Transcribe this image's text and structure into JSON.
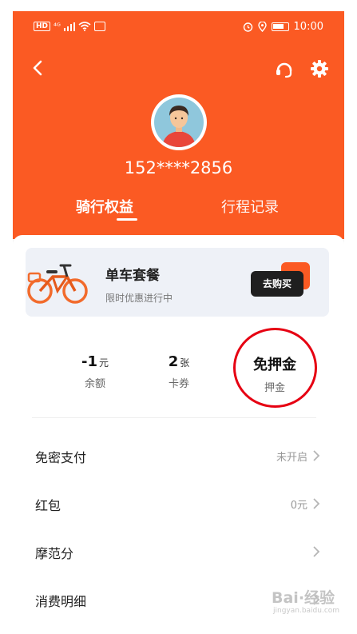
{
  "status_bar": {
    "hd": "HD",
    "signal": "⁴ᴳ",
    "time": "10:00"
  },
  "header": {
    "bg_color": "#fb5a23",
    "phone": "152****2856",
    "tabs": [
      {
        "label": "骑行权益",
        "active": true
      },
      {
        "label": "行程记录",
        "active": false
      }
    ]
  },
  "banner": {
    "title": "单车套餐",
    "subtitle": "限时优惠进行中",
    "button_label": "去购买"
  },
  "stats": {
    "balance": {
      "value": "-1",
      "unit": "元",
      "label": "余额"
    },
    "coupons": {
      "value": "2",
      "unit": "张",
      "label": "卡券"
    },
    "deposit": {
      "value": "免押金",
      "label": "押金"
    }
  },
  "menu": [
    {
      "label": "免密支付",
      "value": "未开启"
    },
    {
      "label": "红包",
      "value": "0元"
    },
    {
      "label": "摩范分",
      "value": ""
    },
    {
      "label": "消费明细",
      "value": ""
    }
  ],
  "watermark": {
    "main": "Bai·经验",
    "sub": "jingyan.baidu.com"
  },
  "colors": {
    "accent": "#fb5a23",
    "annotation": "#e60012"
  }
}
